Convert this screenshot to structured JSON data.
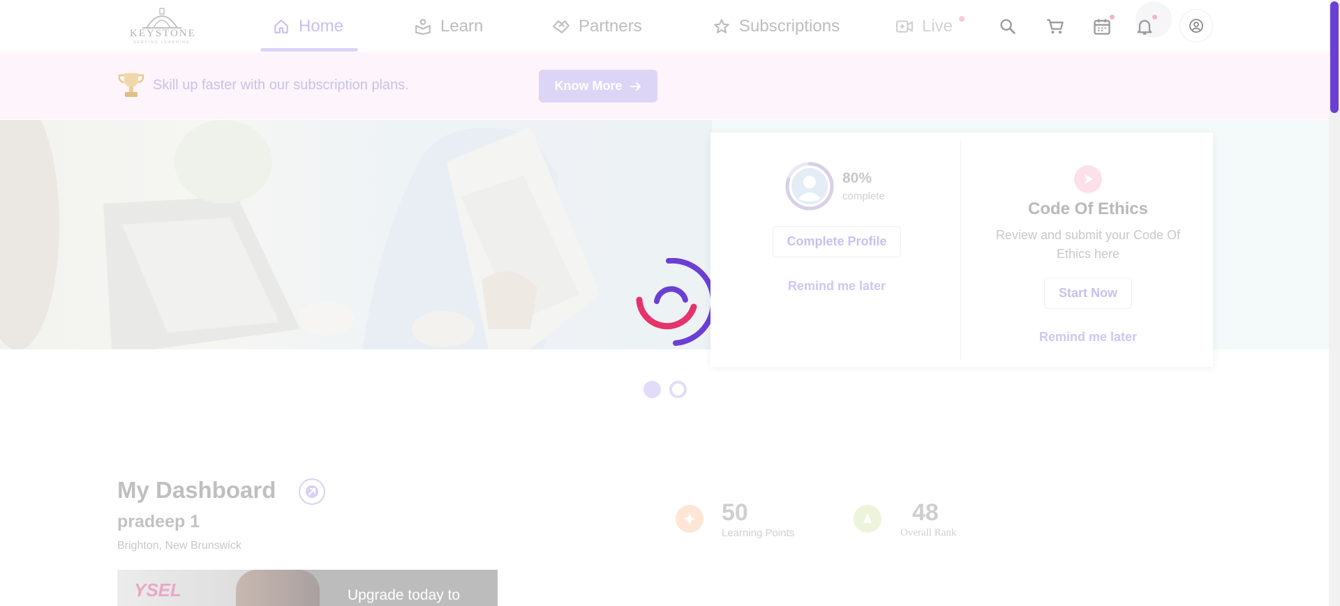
{
  "brand": {
    "name": "KEYSTONE",
    "tagline": "SERVING LEARNING"
  },
  "nav": {
    "home": "Home",
    "learn": "Learn",
    "partners": "Partners",
    "subscriptions": "Subscriptions",
    "live": "Live"
  },
  "promo": {
    "text": "Skill up faster with our subscription plans.",
    "button": "Know More"
  },
  "profile_card": {
    "percent": "80%",
    "percent_value": 0.8,
    "percent_label": "complete",
    "button": "Complete Profile",
    "remind": "Remind me later"
  },
  "ethics_card": {
    "title": "Code Of Ethics",
    "description": "Review and submit your Code Of Ethics here",
    "button": "Start Now",
    "remind": "Remind me later"
  },
  "carousel": {
    "active_index": 0,
    "count": 2
  },
  "dashboard": {
    "title": "My Dashboard",
    "user_name": "pradeep 1",
    "location": "Brighton, New Brunswick",
    "learning_points": "50",
    "learning_points_label": "Learning Points",
    "overall_rank": "48",
    "overall_rank_label": "Overall Rank",
    "upgrade_logo": "YSEL",
    "upgrade_text": "Upgrade today to"
  },
  "colors": {
    "accent": "#6b3fd4",
    "accent_light": "#ddd5f6",
    "promo_bg": "#fdf5fb",
    "spinner_pink": "#e5336b"
  }
}
